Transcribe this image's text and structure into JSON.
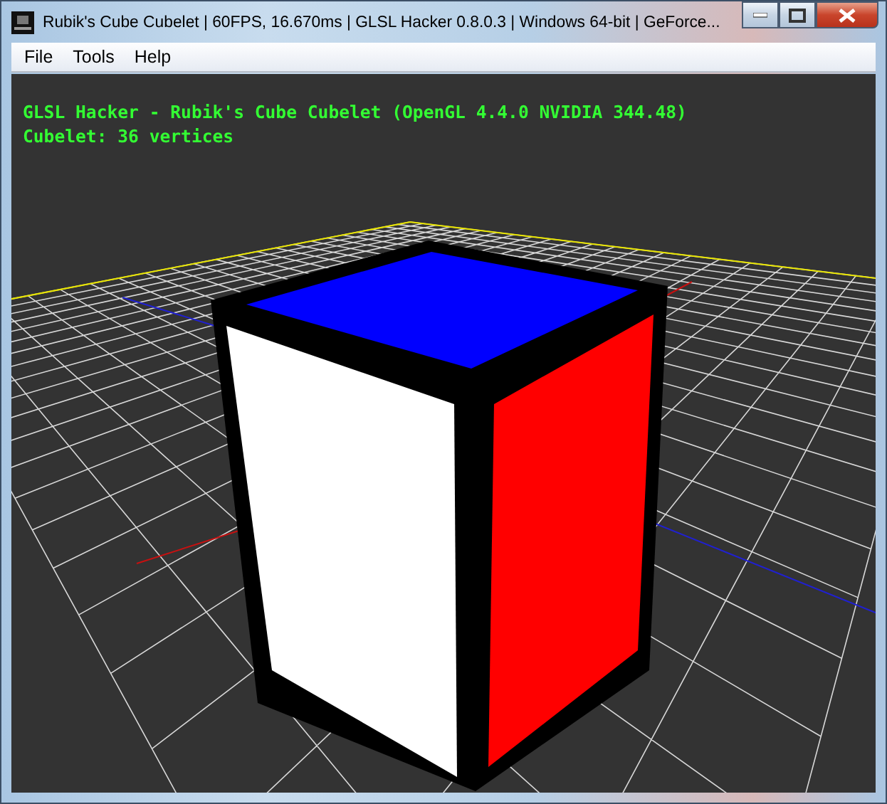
{
  "window": {
    "title": "Rubik's Cube Cubelet | 60FPS, 16.670ms | GLSL Hacker 0.8.0.3 | Windows 64-bit | GeForce..."
  },
  "menu": [
    "File",
    "Tools",
    "Help"
  ],
  "overlay": [
    "GLSL Hacker - Rubik's Cube Cubelet (OpenGL 4.4.0 NVIDIA 344.48)",
    "Cubelet: 36 vertices"
  ]
}
